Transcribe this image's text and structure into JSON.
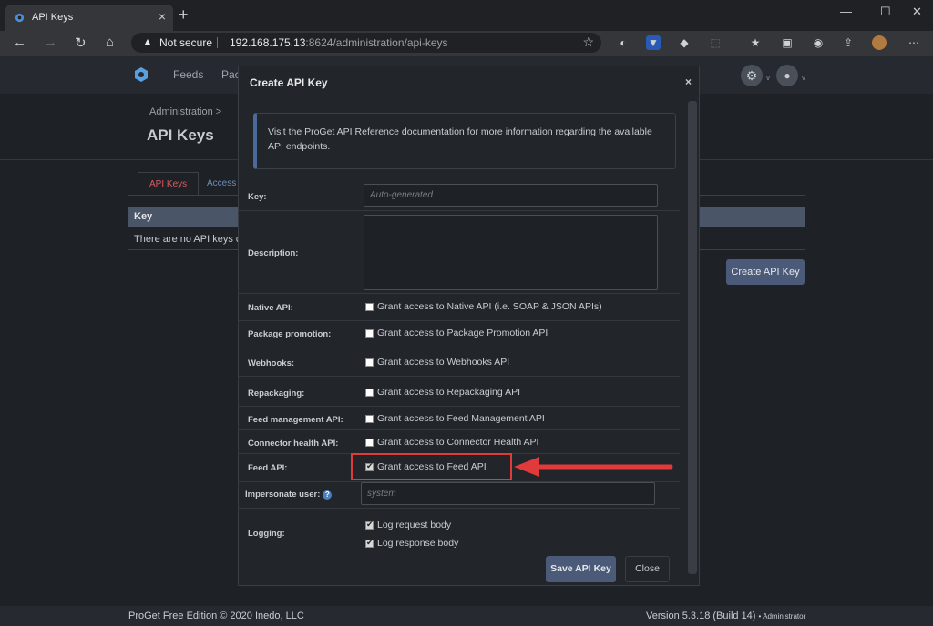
{
  "browser": {
    "tab_title": "API Keys",
    "not_secure": "Not secure",
    "url_host": "192.168.175.13",
    "url_path": ":8624/administration/api-keys"
  },
  "app": {
    "nav": [
      "Feeds",
      "Pac"
    ],
    "breadcrumb": "Administration >",
    "page_title": "API Keys",
    "tabs": [
      "API Keys",
      "Access L"
    ],
    "table_header": "Key",
    "empty_text": "There are no API keys co",
    "create_button": "Create API Key",
    "footer_left": "ProGet Free Edition © 2020 Inedo, LLC",
    "footer_version": "Version 5.3.18 (Build 14)",
    "footer_user": "• Administrator"
  },
  "modal": {
    "title": "Create API Key",
    "close": "×",
    "info_prefix": "Visit the ",
    "info_link": "ProGet API Reference",
    "info_suffix": " documentation for more information regarding the available API endpoints.",
    "key_label": "Key:",
    "key_placeholder": "Auto-generated",
    "desc_label": "Description:",
    "permissions": [
      {
        "label": "Native API:",
        "text": "Grant access to Native API (i.e. SOAP & JSON APIs)",
        "checked": false
      },
      {
        "label": "Package promotion:",
        "text": "Grant access to Package Promotion API",
        "checked": false
      },
      {
        "label": "Webhooks:",
        "text": "Grant access to Webhooks API",
        "checked": false
      },
      {
        "label": "Repackaging:",
        "text": "Grant access to Repackaging API",
        "checked": false
      },
      {
        "label": "Feed management API:",
        "text": "Grant access to Feed Management API",
        "checked": false
      },
      {
        "label": "Connector health API:",
        "text": "Grant access to Connector Health API",
        "checked": false
      },
      {
        "label": "Feed API:",
        "text": "Grant access to Feed API",
        "checked": true
      }
    ],
    "impersonate_label": "Impersonate user:",
    "impersonate_placeholder": "system",
    "logging_label": "Logging:",
    "log_request": "Log request body",
    "log_response": "Log response body",
    "save_button": "Save API Key",
    "close_button": "Close"
  },
  "colors": {
    "highlight": "#e03a3a",
    "primary_button": "#4a5a78"
  }
}
